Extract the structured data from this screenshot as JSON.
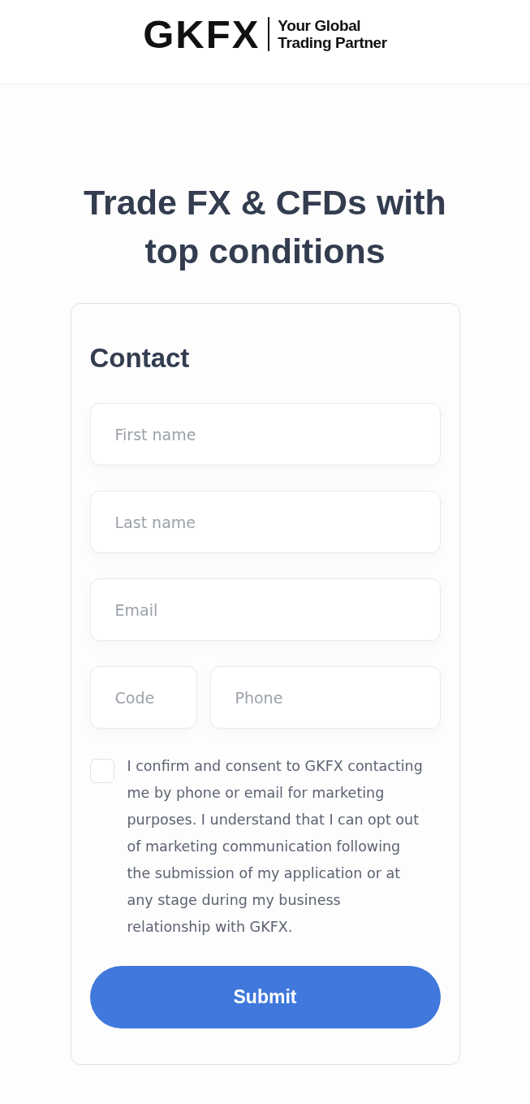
{
  "header": {
    "logo": {
      "wordmark": "GKFX",
      "tagline": [
        "Your Global",
        "Trading Partner"
      ]
    }
  },
  "headline": "Trade FX & CFDs with top conditions",
  "form": {
    "title": "Contact",
    "rows": [
      [
        {
          "kind": "wide",
          "placeholder": "First name"
        }
      ],
      [
        {
          "kind": "wide",
          "placeholder": "Last name"
        }
      ],
      [
        {
          "kind": "wide",
          "placeholder": "Email"
        }
      ],
      [
        {
          "kind": "short",
          "placeholder": "Code"
        },
        {
          "kind": "wide",
          "placeholder": "Phone"
        }
      ]
    ],
    "consent": {
      "checked": false,
      "text": "I confirm and consent to GKFX contacting me by phone or email for marketing purposes. I understand that I can opt out of marketing communication following the submission of my application or at any stage during my business relationship with GKFX."
    },
    "submit": "Submit"
  }
}
